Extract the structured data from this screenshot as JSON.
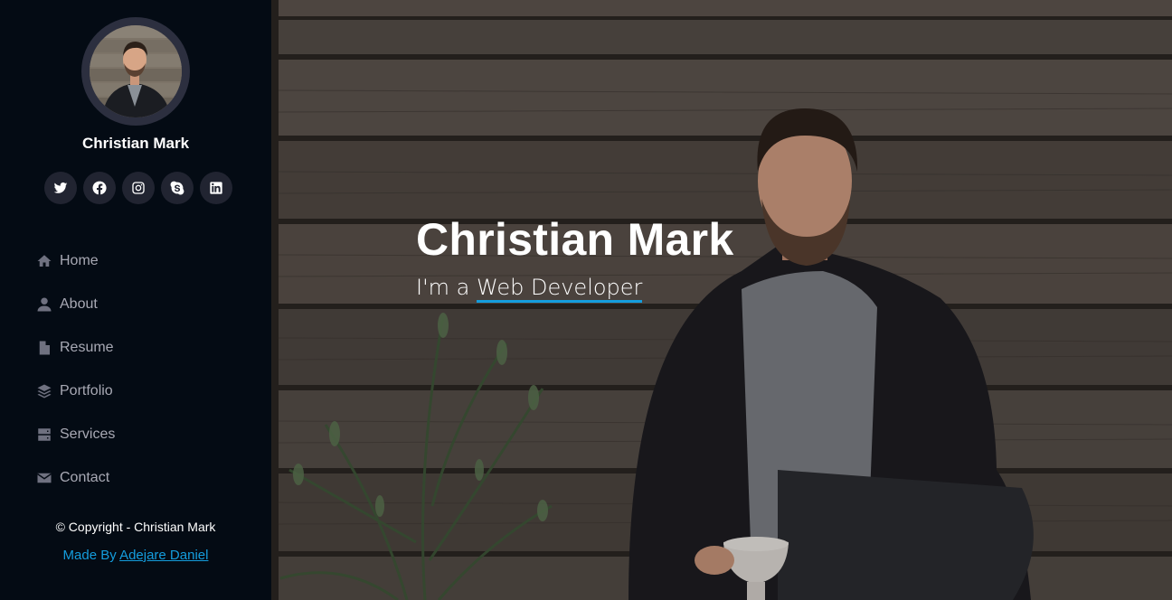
{
  "profile": {
    "name": "Christian Mark"
  },
  "socials": [
    {
      "icon": "twitter-icon"
    },
    {
      "icon": "facebook-icon"
    },
    {
      "icon": "instagram-icon"
    },
    {
      "icon": "skype-icon"
    },
    {
      "icon": "linkedin-icon"
    }
  ],
  "nav": {
    "items": [
      {
        "label": "Home",
        "icon": "home-icon"
      },
      {
        "label": "About",
        "icon": "user-icon"
      },
      {
        "label": "Resume",
        "icon": "file-icon"
      },
      {
        "label": "Portfolio",
        "icon": "layers-icon"
      },
      {
        "label": "Services",
        "icon": "server-icon"
      },
      {
        "label": "Contact",
        "icon": "envelope-icon"
      }
    ]
  },
  "footer": {
    "copyright": "© Copyright - Christian Mark",
    "made_by_prefix": "Made By ",
    "made_by_link": "Adejare Daniel"
  },
  "hero": {
    "title": "Christian Mark",
    "subtitle_prefix": "I'm a ",
    "typed_text": "Web Developer"
  },
  "colors": {
    "sidebar_bg": "#040b14",
    "accent": "#149ddd",
    "nav_text": "#a8a9b4",
    "social_bg": "#212431"
  }
}
